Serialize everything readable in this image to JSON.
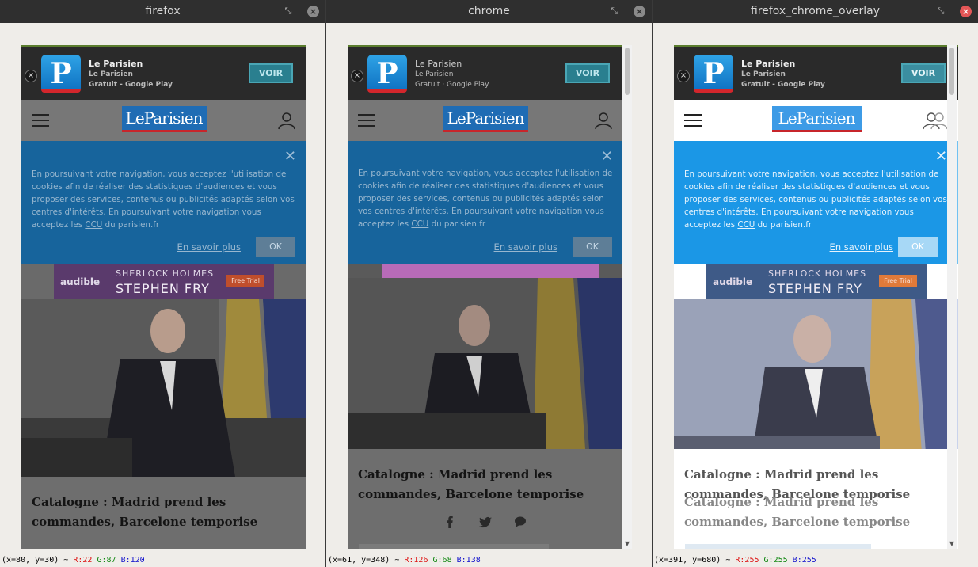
{
  "windows": [
    {
      "title": "firefox",
      "status": {
        "coords": "(x=80, y=30)",
        "r": "R:22",
        "g": "G:87",
        "b": "B:120"
      }
    },
    {
      "title": "chrome",
      "status": {
        "coords": "(x=61, y=348)",
        "r": "R:126",
        "g": "G:68",
        "b": "B:138"
      }
    },
    {
      "title": "firefox_chrome_overlay",
      "status": {
        "coords": "(x=391, y=680)",
        "r": "R:255",
        "g": "G:255",
        "b": "B:255"
      }
    }
  ],
  "status_sep": "~",
  "titlebar_icons": {
    "restore": "restore-arrow-icon",
    "close": "close-icon"
  },
  "page": {
    "app_ad": {
      "name": "Le Parisien",
      "sub1": "Le Parisien",
      "sub2": "Gratuit - Google Play",
      "sub2_chrome": "Gratuit · Google Play",
      "cta": "VOIR",
      "close": "×",
      "logo_letter": "P"
    },
    "site": {
      "logo": "LeParisien"
    },
    "cookie": {
      "text_firefox": "En poursuivant votre navigation, vous acceptez l'utilisation de cookies afin de réaliser des statistiques d'audiences et vous proposer des services, contenus ou publicités adaptés selon vos centres d'intérêts. En poursuivant votre navigation vous acceptez les ",
      "text_chrome": "En poursuivant votre navigation, vous acceptez l'utilisation de cookies afin de réaliser des statistiques d'audiences et vous proposer des services, contenus ou publicités adaptés selon vos centres d'intérêts. En poursuivant votre navigation vous acceptez les ",
      "ccu": "CCU",
      "text_end": " du parisien.fr",
      "learn_more": "En savoir plus",
      "ok": "OK",
      "close": "✕"
    },
    "banner": {
      "brand": "audible",
      "line1": "SHERLOCK HOLMES",
      "line2": "STEPHEN FRY",
      "cta": "Free Trial"
    },
    "article": {
      "headline": "Catalogne : Madrid prend les commandes, Barcelone temporise"
    },
    "social_icons": [
      "facebook-icon",
      "twitter-icon",
      "comment-icon"
    ]
  },
  "colors": {
    "ad_bar": "#2a2a2a",
    "cookie_blue": "#17649c",
    "logo_blue": "#1f6cb4",
    "overlay_cookie": "#1b97e6",
    "chrome_ad_pink": "#b86bb8"
  }
}
